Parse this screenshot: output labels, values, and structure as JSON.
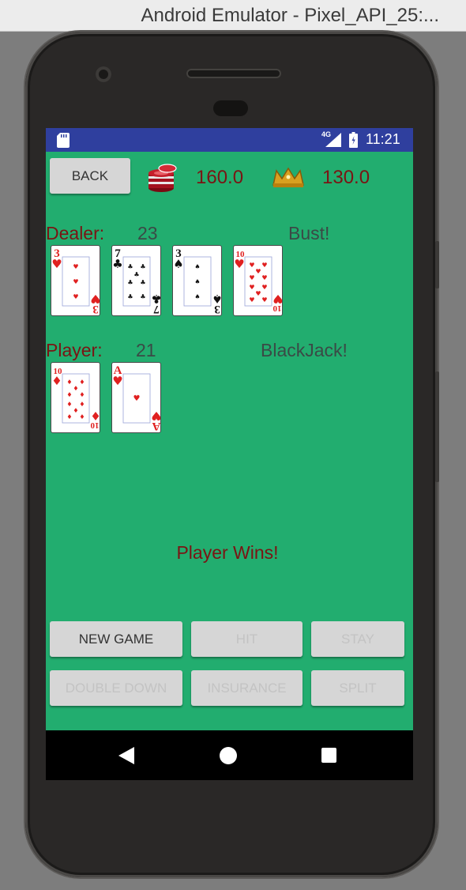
{
  "window": {
    "title": "Android Emulator - Pixel_API_25:..."
  },
  "status_bar": {
    "network": "4G",
    "time": "11:21"
  },
  "header": {
    "back_label": "BACK",
    "chips_value": "160.0",
    "winnings_value": "130.0"
  },
  "dealer": {
    "label": "Dealer:",
    "score": "23",
    "status": "Bust!",
    "cards": [
      {
        "rank": "3",
        "suit": "♥",
        "color": "#e02020"
      },
      {
        "rank": "7",
        "suit": "♣",
        "color": "#111111"
      },
      {
        "rank": "3",
        "suit": "♠",
        "color": "#111111"
      },
      {
        "rank": "10",
        "suit": "♥",
        "color": "#e02020"
      }
    ]
  },
  "player": {
    "label": "Player:",
    "score": "21",
    "status": "BlackJack!",
    "cards": [
      {
        "rank": "10",
        "suit": "♦",
        "color": "#e02020"
      },
      {
        "rank": "A",
        "suit": "♥",
        "color": "#e02020"
      }
    ]
  },
  "result": "Player Wins!",
  "actions": {
    "new_game": "NEW GAME",
    "hit": "HIT",
    "stay": "STAY",
    "double_down": "DOUBLE DOWN",
    "insurance": "INSURANCE",
    "split": "SPLIT"
  },
  "colors": {
    "table_green": "#22ad6f",
    "status_bar_blue": "#2f3f9e",
    "text_dark_red": "#7a1414",
    "text_gray": "#3a4a46"
  },
  "icons": [
    "sd-card-icon",
    "signal-icon",
    "battery-icon",
    "poker-chips-icon",
    "crown-icon",
    "nav-back-icon",
    "nav-home-icon",
    "nav-recents-icon"
  ]
}
